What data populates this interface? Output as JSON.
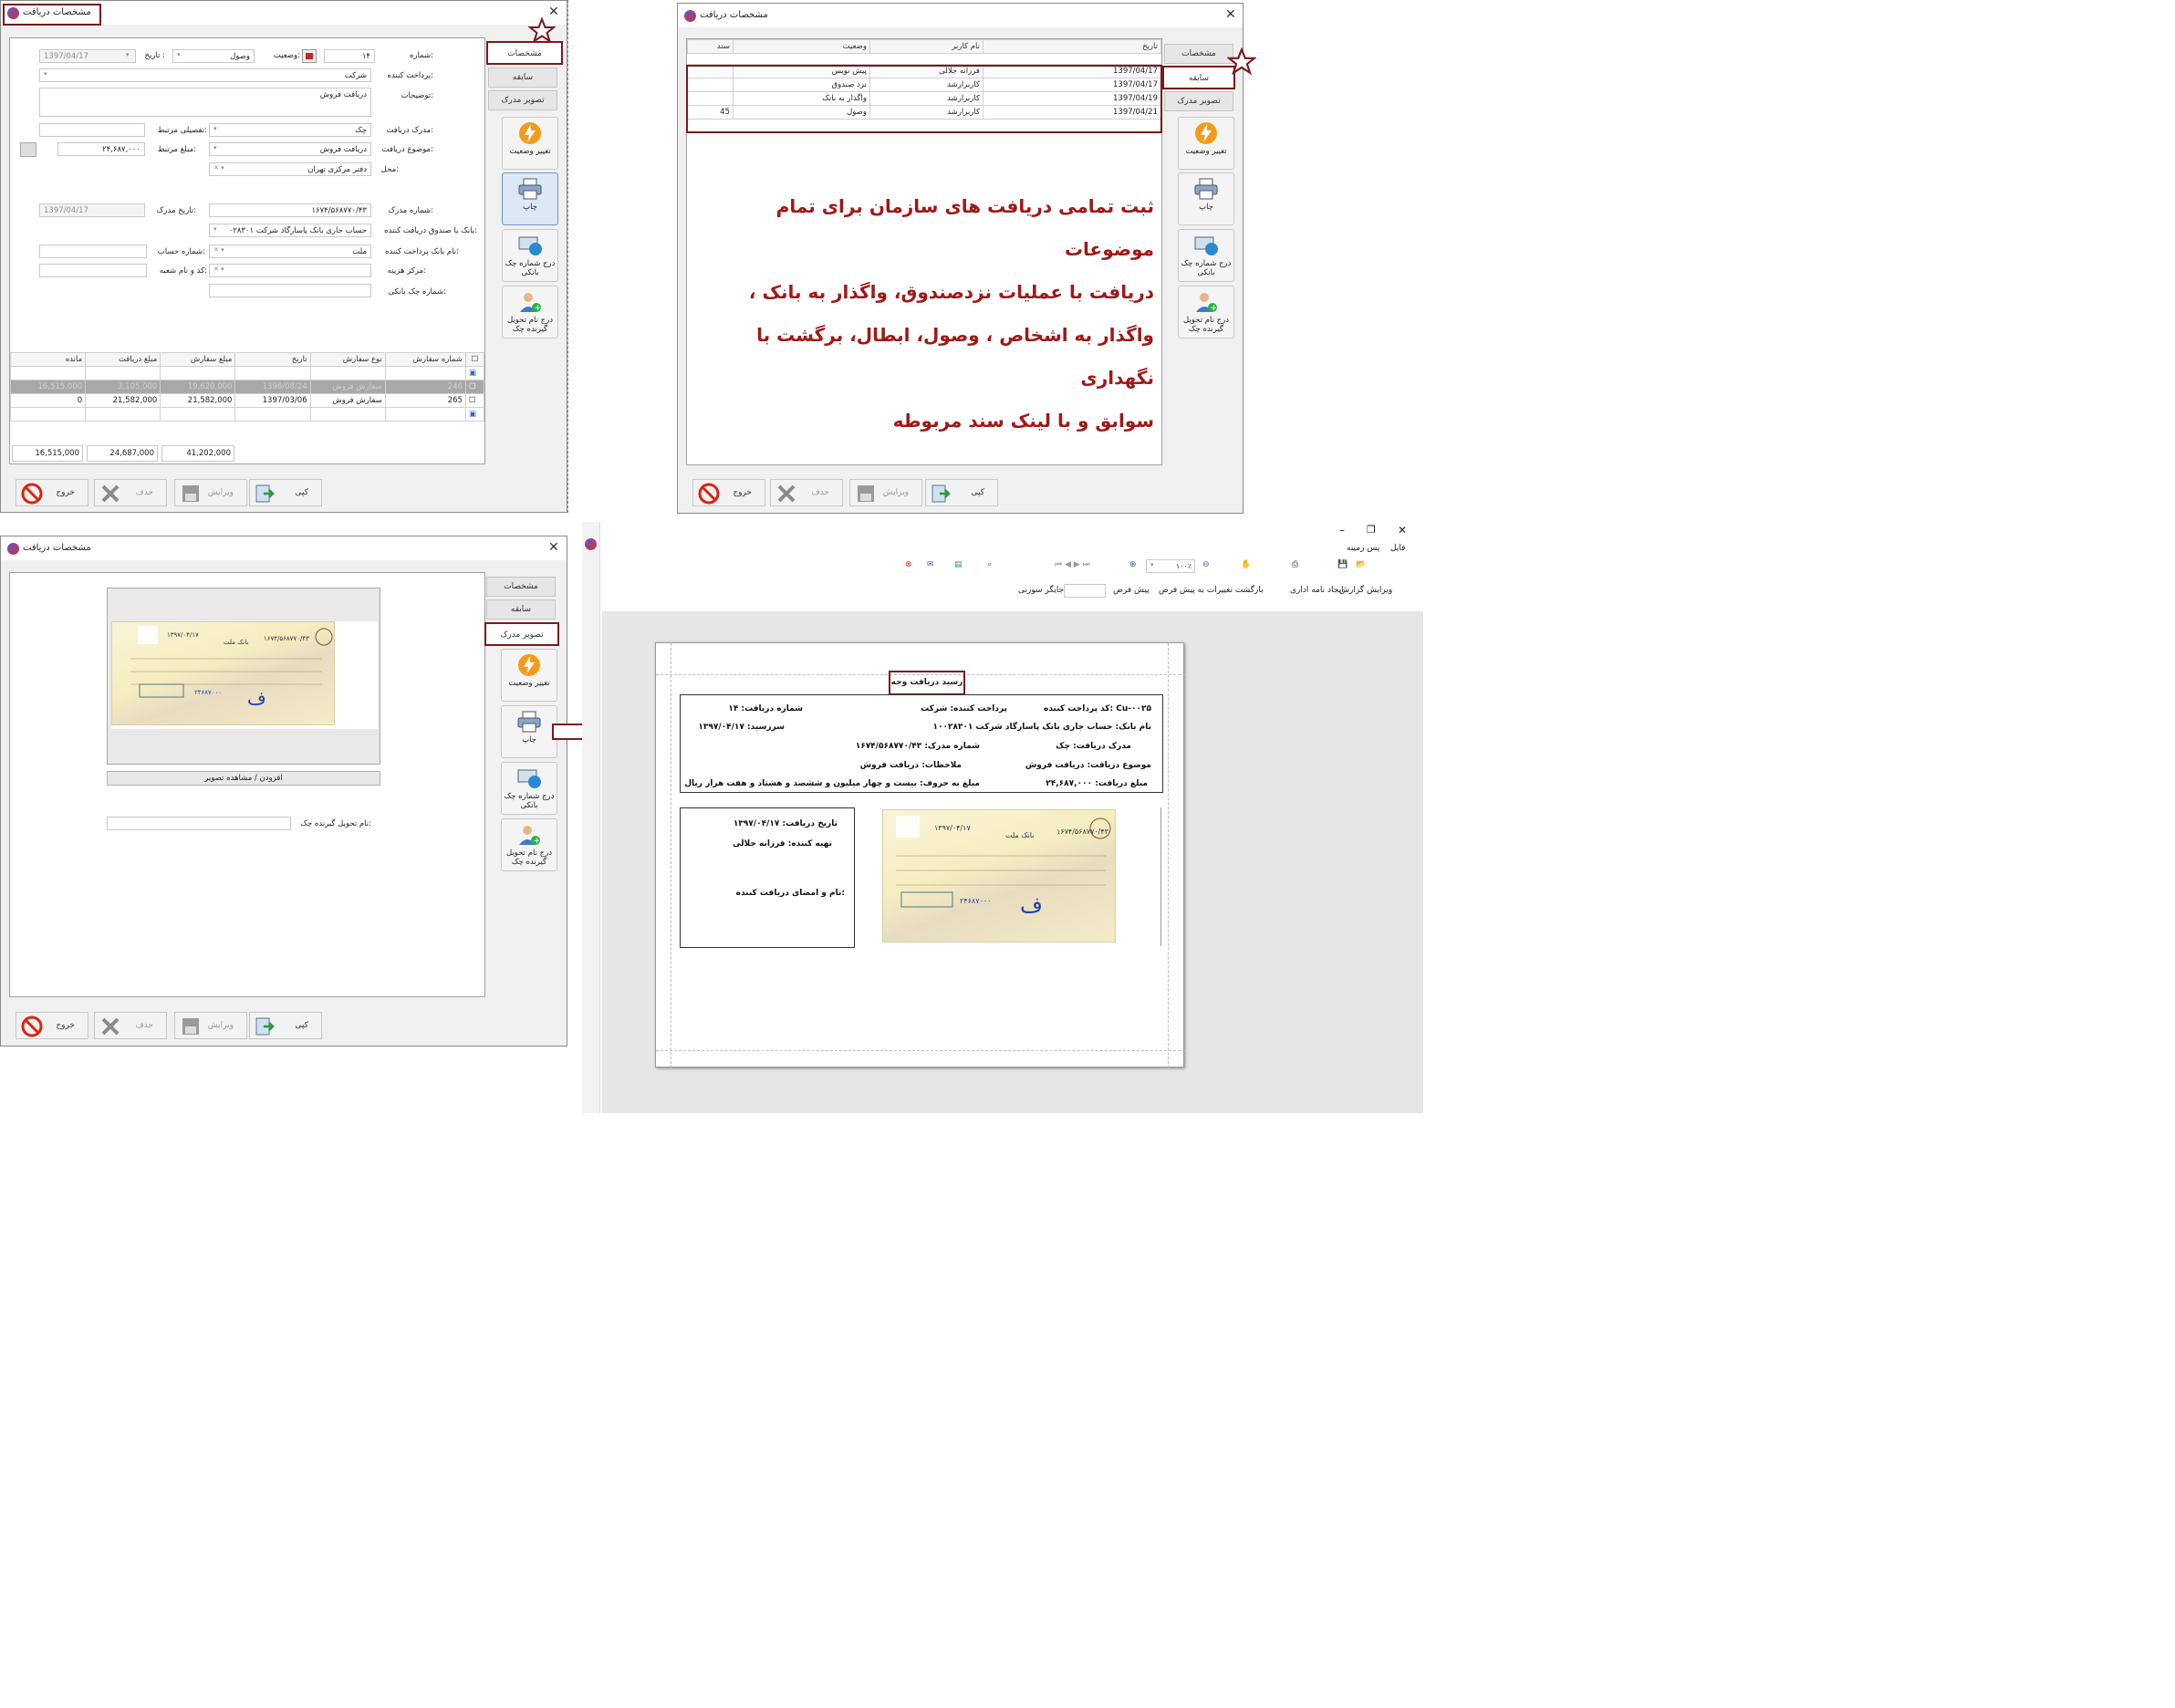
{
  "window_title": "مشخصات دریافت",
  "tabs": {
    "details": "مشخصات",
    "history": "سابقه",
    "document_image": "تصویر مدرک"
  },
  "actions": {
    "change_status": "تغییر وضعیت",
    "print": "چاپ",
    "insert_check_number": "درج شماره چک بانکی",
    "insert_receiver_name": "درج نام تحویل گیرنده چک"
  },
  "bottom": {
    "exit": "خروج",
    "delete": "حذف",
    "edit": "ویرایش",
    "copy": "کپی"
  },
  "form": {
    "number_label": "شماره:",
    "number_value": "۱۴",
    "status_label": "وضعیت:",
    "status_value": "وصول",
    "date_label": "تاریخ :",
    "date_value": "1397/04/17",
    "payer_label": "پرداخت کننده:",
    "payer_value": "شرکت",
    "desc_label": "توضیحات:",
    "desc_value": "دریافت فروش",
    "doc_label": "مدرک دریافت:",
    "doc_value": "چک",
    "detail_label": "تفصیلی مرتبط:",
    "subject_label": "موضوع دریافت:",
    "subject_value": "دریافت فروش",
    "amount_label": "مبلغ مرتبط:",
    "amount_value": "۲۴,۶۸۷,۰۰۰",
    "place_label": "محل:",
    "place_value": "دفتر مرکزی تهران",
    "docnum_label": "شماره مدرک:",
    "docnum_value": "۱۶۷۴/۵۶۸۷۷۰/۴۳",
    "docdate_label": "تاریخ مدرک:",
    "docdate_value": "1397/04/17",
    "bank_label": "بانک یا صندوق دریافت کننده:",
    "bank_value": "حساب جاری  بانک پاسارگاد شرکت ۰۲۸۳۰۱",
    "acct_label": "شماره حساب:",
    "payer_bank_label": "نام بانک پرداخت کننده:",
    "payer_bank_value": "ملت",
    "branch_label": "کد و نام شعبه:",
    "cost_label": "مرکز هزینه:",
    "check_label": "شماره چک بانکی:"
  },
  "orders": {
    "headers": [
      "شماره سفارش",
      "نوع سفارش",
      "تاریخ",
      "مبلغ سفارش",
      "مبلغ دریافت",
      "مانده"
    ],
    "rows": [
      [
        "246",
        "سفارش فروش",
        "1396/08/24",
        "19,620,000",
        "3,105,000",
        "16,515,000"
      ],
      [
        "265",
        "سفارش فروش",
        "1397/03/06",
        "21,582,000",
        "21,582,000",
        "0"
      ]
    ],
    "totals": [
      "41,202,000",
      "24,687,000",
      "16,515,000"
    ]
  },
  "history": {
    "headers": [
      "تاریخ",
      "نام کاربر",
      "وضعیت",
      "سند"
    ],
    "rows": [
      [
        "1397/04/17",
        "فرزانه جلالی",
        "پیش نویس",
        ""
      ],
      [
        "1397/04/17",
        "کاربرارشد",
        "نزد صندوق",
        ""
      ],
      [
        "1397/04/19",
        "کاربرارشد",
        "واگذار به بانک",
        ""
      ],
      [
        "1397/04/21",
        "کاربرارشد",
        "وصول",
        "45"
      ]
    ]
  },
  "description_lines": [
    "ثبت تمامی دریافت های سازمان برای تمام موضوعات",
    "دریافت با عملیات نزدصندوق، واگذار به  بانک ،",
    "واگذار به اشخاص ، وصول، ابطال، برگشت با نگهداری",
    "سوابق و با لینک سند مربوطه"
  ],
  "image_tab": {
    "add_view_button": "افزودن / مشاهده تصویر",
    "receiver_label": "نام تحویل گیرنده چک:"
  },
  "check": {
    "bank": "بانک ملت",
    "number": "۱۶۷۴/۵۶۸۷۷۰/۴۳",
    "date": "۱۳۹۷/۰۴/۱۷",
    "amount": "۲۴۶۸۷۰۰۰"
  },
  "report": {
    "menu": [
      "فایل",
      "پس زمینه"
    ],
    "toolbar_zoom": "۱۰۰٪",
    "toolbar2": [
      "ویرایش گزارش",
      "ایجاد نامه اداری",
      "بازگشت تغییرات به پیش فرض",
      "پیش فرض",
      "جایگر سوزنی"
    ],
    "title": "رسید دریافت وجه",
    "r1": [
      "کد پرداخت کننده: Cu-۰۰۲۵",
      "پرداخت کننده: شرکت",
      "شماره دریافت: ۱۴"
    ],
    "r2": [
      "نام بانک: حساب جاری  بانک پاسارگاد شرکت ۱۰۰۲۸۳۰۱",
      "سررسید: ۱۳۹۷/۰۴/۱۷"
    ],
    "r3": [
      "مدرک دریافت: چک",
      "شماره مدرک: ۱۶۷۴/۵۶۸۷۷۰/۴۳"
    ],
    "r4": [
      "موضوع دریافت: دریافت فروش",
      "ملاحظات: دریافت فروش"
    ],
    "r5": [
      "مبلغ دریافت: ۲۴,۶۸۷,۰۰۰",
      "مبلغ به حروف: بیست و چهار میلیون و ششصد و هشتاد و هفت هزار  ریال"
    ],
    "box": [
      "تاریخ دریافت: ۱۳۹۷/۰۴/۱۷",
      "تهیه کننده: فرزانه جلالی",
      "نام و امضای دریافت کننده:"
    ]
  },
  "colors": {
    "accent_red": "#7a1a1a",
    "desc_text": "#a01818",
    "selected_row": "#a8a8a8"
  }
}
